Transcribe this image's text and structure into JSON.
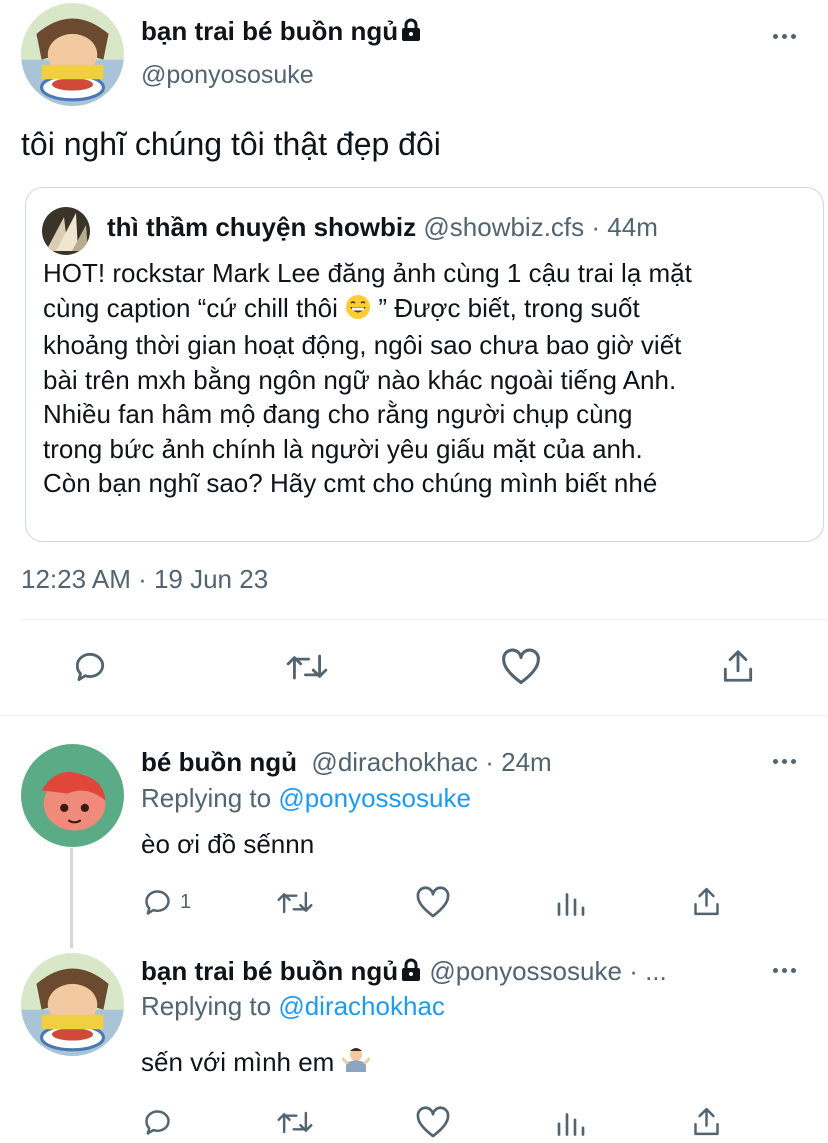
{
  "main_tweet": {
    "display_name": "bạn trai bé buồn ngủ",
    "handle": "@ponyososuke",
    "text": "tôi nghĩ chúng tôi thật đẹp đôi",
    "timestamp": "12:23 AM · 19 Jun 23"
  },
  "quoted_tweet": {
    "display_name": "thì thầm chuyện showbiz",
    "handle": "@showbiz.cfs",
    "time": "· 44m",
    "lines": [
      "HOT! rockstar Mark Lee đăng ảnh cùng 1 cậu trai lạ mặt",
      "cùng caption “cứ chill thôi",
      " ” Được biết, trong suốt",
      "khoảng thời gian hoạt động, ngôi sao chưa bao giờ viết",
      "bài trên mxh bằng ngôn ngữ nào khác ngoài tiếng Anh.",
      "Nhiều fan hâm mộ đang cho rằng người chụp cùng",
      "trong bức ảnh chính là người yêu giấu mặt của anh.",
      "Còn bạn nghĩ sao? Hãy cmt cho chúng mình biết nhé"
    ]
  },
  "replies": [
    {
      "display_name": "bé buồn ngủ",
      "handle": "@dirachokhac",
      "time": "· 24m",
      "replying_label": "Replying to",
      "replying_to": "@ponyossosuke",
      "text": "èo ơi đồ sếnnn",
      "reply_count": "1"
    },
    {
      "display_name": "bạn trai bé buồn ngủ",
      "handle": "@ponyossosuke",
      "time": "· ...",
      "replying_label": "Replying to",
      "replying_to": "@dirachokhac",
      "text": "sến với mình em"
    }
  ],
  "colors": {
    "accent": "#1d9bf0",
    "text": "#0f1419",
    "muted": "#536471",
    "border": "#cfd9de"
  },
  "icons": [
    "lock-icon",
    "more-icon",
    "reply-icon",
    "retweet-icon",
    "like-icon",
    "share-icon",
    "analytics-icon",
    "grin-emoji",
    "shrug-emoji"
  ]
}
